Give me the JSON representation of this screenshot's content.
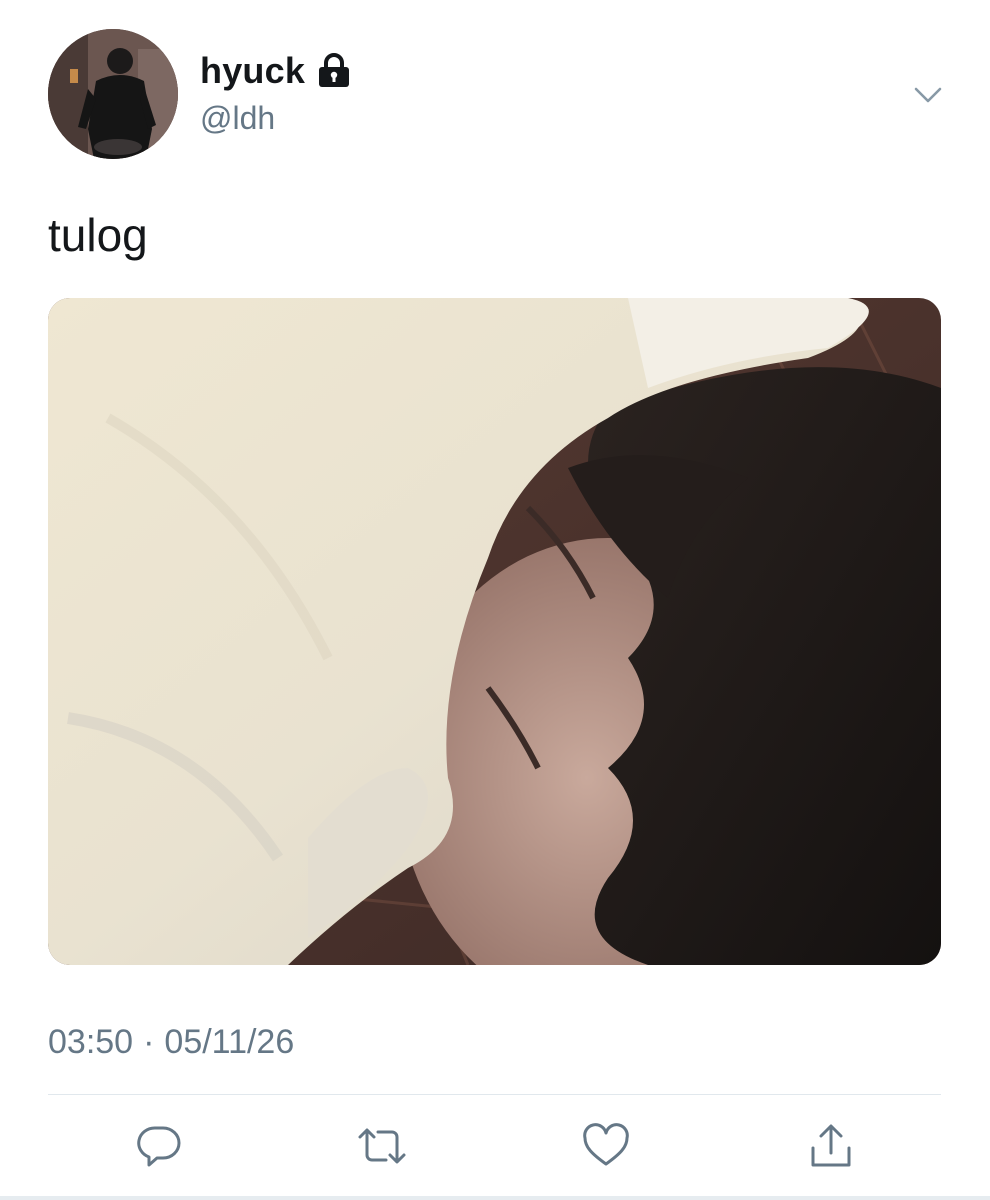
{
  "user": {
    "display_name": "hyuck",
    "handle": "@ldh",
    "protected_icon": "lock-icon",
    "avatar_icon": "profile-photo"
  },
  "tweet": {
    "text": "tulog",
    "media_description": "photo",
    "time": "03:50",
    "separator": "·",
    "date": "05/11/26"
  },
  "actions": {
    "reply_icon": "reply-icon",
    "retweet_icon": "retweet-icon",
    "like_icon": "heart-icon",
    "share_icon": "share-icon",
    "more_icon": "chevron-down-icon"
  },
  "colors": {
    "text_primary": "#14171a",
    "text_secondary": "#657786",
    "icon": "#657786",
    "divider": "#e1e8ed"
  }
}
